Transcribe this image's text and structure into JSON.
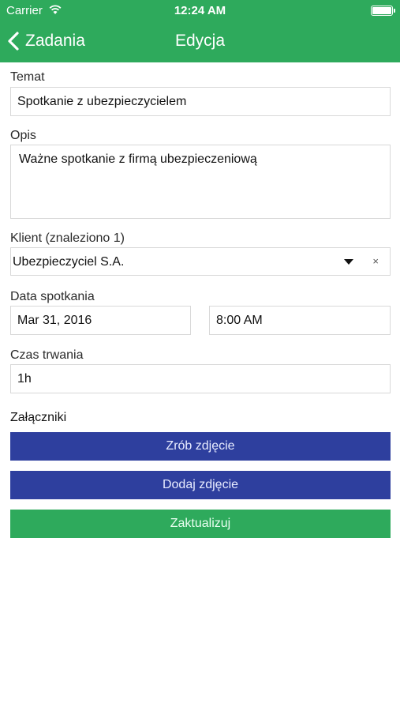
{
  "status_bar": {
    "carrier": "Carrier",
    "time": "12:24 AM"
  },
  "nav": {
    "back_label": "Zadania",
    "title": "Edycja"
  },
  "form": {
    "subject": {
      "label": "Temat",
      "value": "Spotkanie z ubezpieczycielem"
    },
    "description": {
      "label": "Opis",
      "value": "Ważne spotkanie z firmą ubezpieczeniową"
    },
    "client": {
      "label": "Klient (znaleziono 1)",
      "value": "Ubezpieczyciel S.A.",
      "clear": "×"
    },
    "meeting_date": {
      "label": "Data spotkania",
      "date": "Mar 31, 2016",
      "time": "8:00 AM"
    },
    "duration": {
      "label": "Czas trwania",
      "value": "1h"
    }
  },
  "attachments": {
    "heading": "Załączniki",
    "take_photo_label": "Zrób zdjęcie",
    "add_photo_label": "Dodaj zdjęcie"
  },
  "update_label": "Zaktualizuj",
  "colors": {
    "brand_green": "#2eaa5c",
    "button_blue": "#2e3f9e"
  }
}
